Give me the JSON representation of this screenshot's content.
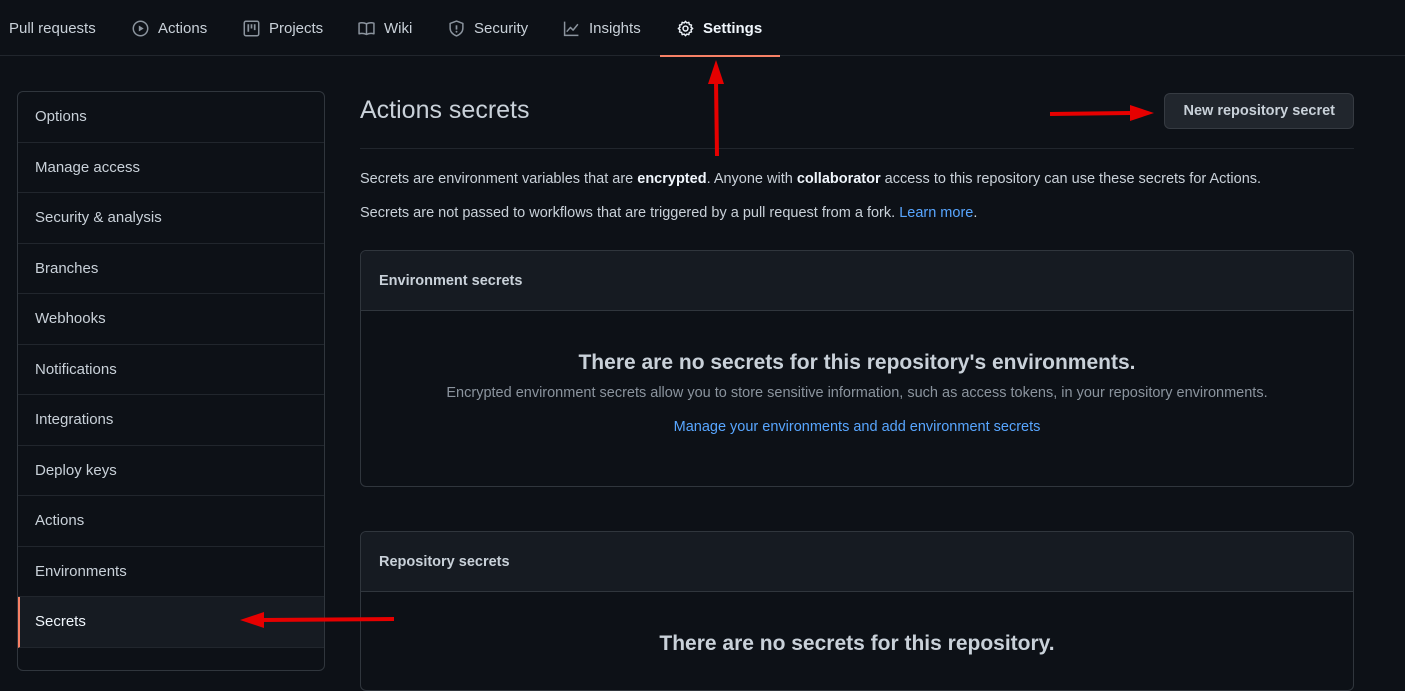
{
  "nav": {
    "tabs": [
      {
        "label": "Pull requests",
        "icon": ""
      },
      {
        "label": "Actions",
        "icon": "play-circle-icon"
      },
      {
        "label": "Projects",
        "icon": "project-board-icon"
      },
      {
        "label": "Wiki",
        "icon": "book-icon"
      },
      {
        "label": "Security",
        "icon": "shield-icon"
      },
      {
        "label": "Insights",
        "icon": "graph-icon"
      },
      {
        "label": "Settings",
        "icon": "gear-icon",
        "active": true
      }
    ]
  },
  "sidebar": {
    "items": [
      {
        "label": "Options"
      },
      {
        "label": "Manage access"
      },
      {
        "label": "Security & analysis"
      },
      {
        "label": "Branches"
      },
      {
        "label": "Webhooks"
      },
      {
        "label": "Notifications"
      },
      {
        "label": "Integrations"
      },
      {
        "label": "Deploy keys"
      },
      {
        "label": "Actions"
      },
      {
        "label": "Environments"
      },
      {
        "label": "Secrets",
        "active": true
      }
    ]
  },
  "main": {
    "title": "Actions secrets",
    "new_secret_button": "New repository secret",
    "desc1": {
      "a": "Secrets are environment variables that are ",
      "b": "encrypted",
      "c": ". Anyone with ",
      "d": "collaborator",
      "e": " access to this repository can use these secrets for Actions."
    },
    "desc2": {
      "a": "Secrets are not passed to workflows that are triggered by a pull request from a fork. ",
      "link": "Learn more",
      "b": "."
    },
    "env_box": {
      "header": "Environment secrets",
      "blank_title": "There are no secrets for this repository's environments.",
      "blank_text": "Encrypted environment secrets allow you to store sensitive information, such as access tokens, in your repository environments.",
      "blank_link": "Manage your environments and add environment secrets"
    },
    "repo_box": {
      "header": "Repository secrets",
      "blank_title": "There are no secrets for this repository."
    }
  },
  "colors": {
    "background": "#0d1117",
    "accent_underline": "#f78166",
    "link": "#58a6ff",
    "annotation_arrow": "#e60000"
  }
}
